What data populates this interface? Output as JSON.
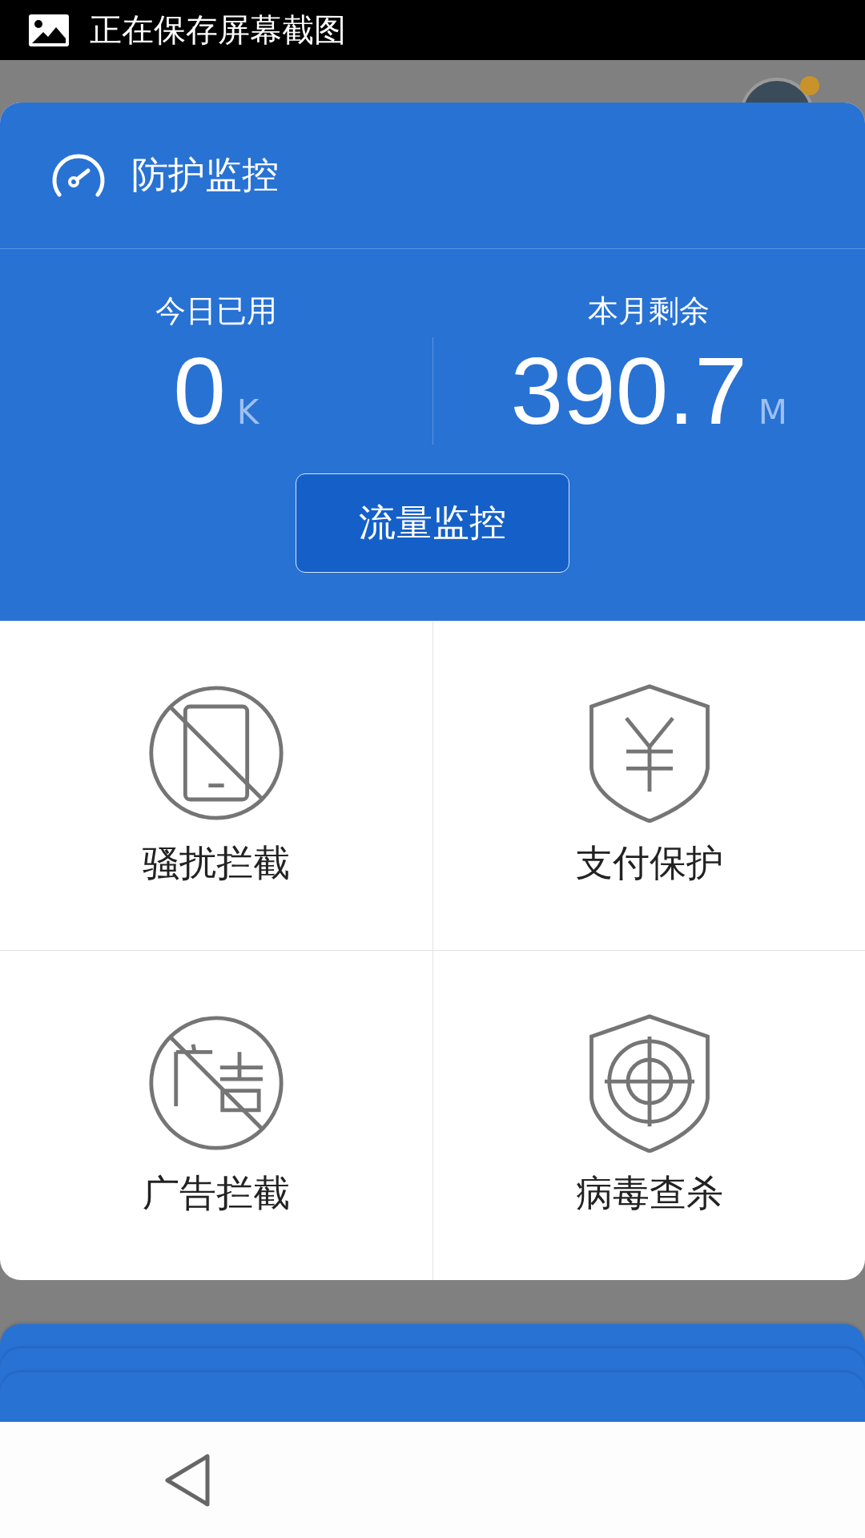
{
  "status_bar": {
    "notification": "正在保存屏幕截图"
  },
  "card": {
    "title": "防护监控",
    "stats": [
      {
        "label": "今日已用",
        "value": "0",
        "unit": "K"
      },
      {
        "label": "本月剩余",
        "value": "390.7",
        "unit": "M"
      }
    ],
    "button": "流量监控",
    "features": [
      {
        "kind": "phone-block",
        "label": "骚扰拦截"
      },
      {
        "kind": "shield-yen",
        "label": "支付保护"
      },
      {
        "kind": "ad-block",
        "label": "广告拦截"
      },
      {
        "kind": "shield-target",
        "label": "病毒查杀"
      }
    ]
  }
}
